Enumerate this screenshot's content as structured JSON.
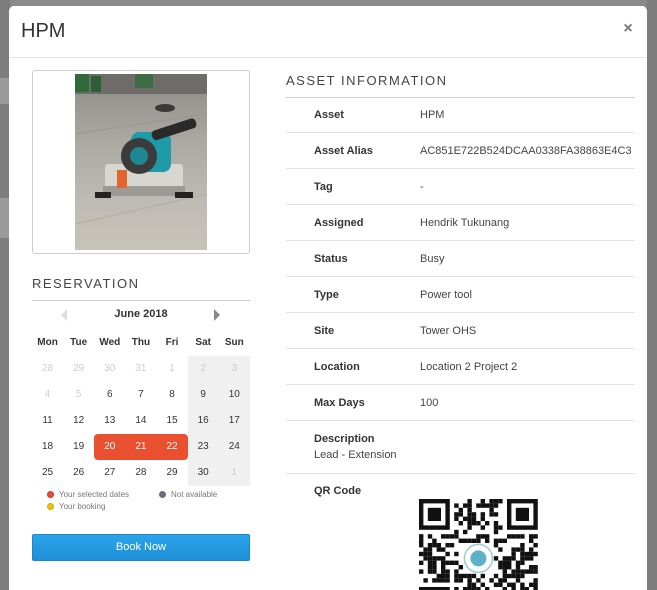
{
  "modal": {
    "title": "HPM",
    "close_glyph": "×"
  },
  "reservation": {
    "title": "RESERVATION",
    "month": "June 2018",
    "weekdays": [
      "Mon",
      "Tue",
      "Wed",
      "Thu",
      "Fri",
      "Sat",
      "Sun"
    ],
    "weeks": [
      [
        "28",
        "29",
        "30",
        "31",
        "1",
        "2",
        "3"
      ],
      [
        "4",
        "5",
        "6",
        "7",
        "8",
        "9",
        "10"
      ],
      [
        "11",
        "12",
        "13",
        "14",
        "15",
        "16",
        "17"
      ],
      [
        "18",
        "19",
        "20",
        "21",
        "22",
        "23",
        "24"
      ],
      [
        "25",
        "26",
        "27",
        "28",
        "29",
        "30",
        "1"
      ]
    ],
    "selected_dates": [
      "20",
      "21",
      "22"
    ],
    "legend": {
      "selected": "Your selected dates",
      "unavailable": "Not available",
      "booking": "Your booking"
    },
    "colors": {
      "selected": "#e8502f",
      "unavailable": "#6b6b7b",
      "booking": "#f2c200",
      "button": "#1f8fd6"
    },
    "book_button": "Book Now"
  },
  "asset_info": {
    "title": "ASSET INFORMATION",
    "rows": [
      {
        "label": "Asset",
        "value": "HPM"
      },
      {
        "label": "Asset Alias",
        "value": "AC851E722B524DCAA0338FA38863E4C3"
      },
      {
        "label": "Tag",
        "value": "-"
      },
      {
        "label": "Assigned",
        "value": "Hendrik Tukunang"
      },
      {
        "label": "Status",
        "value": "Busy"
      },
      {
        "label": "Type",
        "value": "Power tool"
      },
      {
        "label": "Site",
        "value": "Tower OHS"
      },
      {
        "label": "Location",
        "value": "Location 2 Project 2"
      },
      {
        "label": "Max Days",
        "value": "100"
      }
    ],
    "description_label": "Description",
    "description_value": "Lead - Extension",
    "qr_label": "QR Code"
  }
}
